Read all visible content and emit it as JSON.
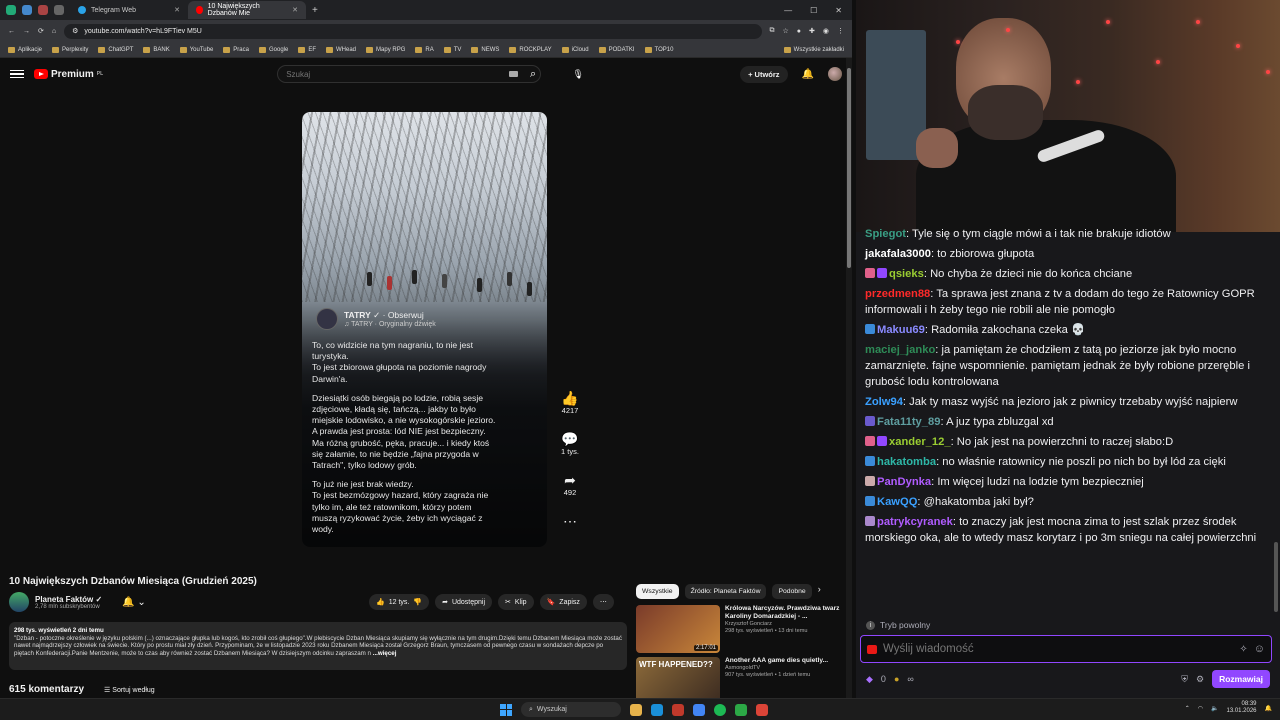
{
  "browser": {
    "tabs": [
      {
        "label": "Telegram Web",
        "active": false
      },
      {
        "label": "10 Największych Dzbanów Mie",
        "active": true
      }
    ],
    "url": "youtube.com/watch?v=hL9FTiev M5U",
    "bookmarks": [
      "Aplikacje",
      "Perplexity",
      "ChatGPT",
      "BANK",
      "YouTube",
      "Praca",
      "Google",
      "EF",
      "WHead",
      "Mapy RPG",
      "RA",
      "TV",
      "NEWS",
      "ROCKPLAY",
      "iCloud",
      "PODATKI",
      "TOP10"
    ],
    "bookmarks_all": "Wszystkie zakładki"
  },
  "yt": {
    "logo": "Premium",
    "logo_sup": "PL",
    "search_placeholder": "Szukaj",
    "create_label": "Utwórz"
  },
  "short": {
    "channel": "TATRY",
    "follow": "Obserwuj",
    "sound": "TATRY · Oryginalny dźwięk",
    "paragraphs": [
      "To, co widzicie na tym nagraniu, to nie jest\nturystyka.\nTo jest zbiorowa głupota na poziomie nagrody\nDarwin'a.",
      "Dziesiątki osób biegają po lodzie, robią sesje\nzdjęciowe, kładą się, tańczą... jakby to było\nmiejskie lodowisko, a nie wysokogórskie jezioro.\nA prawda jest prosta: lód NIE jest bezpieczny.\nMa różną grubość, pęka, pracuje... i kiedy ktoś\nsię załamie, to nie będzie „fajna przygoda w\nTatrach\", tylko lodowy grób.",
      "To już nie jest brak wiedzy.\nTo jest bezmózgowy hazard, który zagraża nie\ntylko im, ale też ratownikom, którzy potem\nmuszą ryzykować życie, żeby ich wyciągać z\nwody."
    ],
    "likes": "4217",
    "comments": "1 tys.",
    "shares": "492"
  },
  "video": {
    "title": "10 Największych Dzbanów Miesiąca (Grudzień 2025)",
    "channel": "Planeta Faktów",
    "subs": "2,78 mln subskrybentów",
    "likes": "12 tys.",
    "share": "Udostępnij",
    "clip": "Klip",
    "save": "Zapisz",
    "views": "298 tys. wyświetleń  2 dni temu",
    "description": "\"Dzban - potoczne określenie w języku polskim (...) oznaczające głupka lub kogoś, kto zrobił coś głupiego\".W plebiscycie Dzban Miesiąca skupiamy się wyłącznie na tym drugim.Dzięki temu Dzbanem Miesiąca może zostać nawet najmądrzejszy człowiek na świecie. Który po prostu miał zły dzień. Przypominam, że w listopadzie 2023 roku Dzbanem Miesiąca został Grzegorz Braun, tymczasem od pewnego czasu w sondażach depcze po piętach Konfederacji.Panie Mentzenie, może to czas aby również zostać Dzbanem Miesiąca? W dzisiejszym odcinku zapraszam n",
    "more": "...więcej",
    "comments_count": "615 komentarzy",
    "sort_label": "Sortuj według"
  },
  "recommendations": {
    "chips": [
      "Wszystkie",
      "Źródło: Planeta Faktów",
      "Podobne"
    ],
    "items": [
      {
        "title": "Królowa Narcyzów. Prawdziwa twarz Karoliny Domaradzkiej - ...",
        "channel": "Krzysztof Gonciarz",
        "meta": "298 tys. wyświetleń • 13 dni temu",
        "duration": "2:17:01",
        "thumb_color": "#7a3b2a"
      },
      {
        "title": "Another AAA game dies quietly...",
        "channel": "AsmongoldTV",
        "meta": "907 tys. wyświetleń • 1 dzień temu",
        "duration": "",
        "thumb_color": "#8c6a3a",
        "thumb_text": "WTF HAPPENED??"
      }
    ]
  },
  "chat": {
    "messages": [
      {
        "user": "Spiegot",
        "color": "#3a9e84",
        "text": "Tyle się o tym ciągle mówi a i tak nie brakuje idiotów",
        "badges": []
      },
      {
        "user": "jakafala3000",
        "color": "#ffffff",
        "text": "to zbiorowa głupota",
        "badges": []
      },
      {
        "user": "qsieks",
        "color": "#9acd32",
        "text": "No chyba że dzieci nie do końca chciane",
        "badges": [
          "#e0608a",
          "#9147ff"
        ]
      },
      {
        "user": "przedmen88",
        "color": "#ff2a2a",
        "text": "Ta sprawa jest znana z tv a dodam do tego że Ratownicy GOPR informowali i h żeby tego nie robili ale nie pomogło",
        "badges": []
      },
      {
        "user": "Makuu69",
        "color": "#8a8aff",
        "text": "Radomiła zakochana czeka 💀",
        "badges": [
          "#3a8ad8"
        ]
      },
      {
        "user": "maciej_janko",
        "color": "#2e8b57",
        "text": "ja pamiętam że chodziłem z tatą po jeziorze jak było mocno zamarznięte. fajne wspomnienie. pamiętam jednak że były robione przeręble i grubość lodu kontrolowana",
        "badges": []
      },
      {
        "user": "Zolw94",
        "color": "#3aa0ff",
        "text": "Jak ty masz wyjść na jezioro jak z piwnicy trzebaby wyjść najpierw",
        "badges": []
      },
      {
        "user": "Fata11ty_89",
        "color": "#5f9ea0",
        "text": "A juz typa zbluzgal xd",
        "badges": [
          "#6a5acd"
        ]
      },
      {
        "user": "xander_12_",
        "color": "#9acd32",
        "text": "No jak jest na powierzchni to raczej słabo:D",
        "badges": [
          "#e0608a",
          "#9147ff"
        ]
      },
      {
        "user": "hakatomba",
        "color": "#2eb8a8",
        "text": "no właśnie ratownicy nie poszli po nich bo był lód za cięki",
        "badges": [
          "#3a8ad8"
        ]
      },
      {
        "user": "PanDynka",
        "color": "#b05cff",
        "text": "Im więcej ludzi na lodzie tym bezpieczniej",
        "badges": [
          "#caa"
        ]
      },
      {
        "user": "KawQQ",
        "color": "#3aa0ff",
        "text": "@hakatomba jaki był?",
        "badges": [
          "#3a8ad8"
        ]
      },
      {
        "user": "patrykcyranek",
        "color": "#b05cff",
        "text": "to znaczy jak jest mocna zima to jest szlak przez środek morskiego oka, ale to wtedy masz korytarz i po 3m sniegu na całej powierzchni",
        "badges": [
          "#aa88cc"
        ]
      }
    ],
    "slow_mode": "Tryb powolny",
    "input_placeholder": "Wyślij wiadomość",
    "points": "0",
    "infinity": "∞",
    "send_label": "Rozmawiaj"
  },
  "taskbar": {
    "search_placeholder": "Wyszukaj",
    "time": "08:39",
    "date": "13.01.2026"
  }
}
